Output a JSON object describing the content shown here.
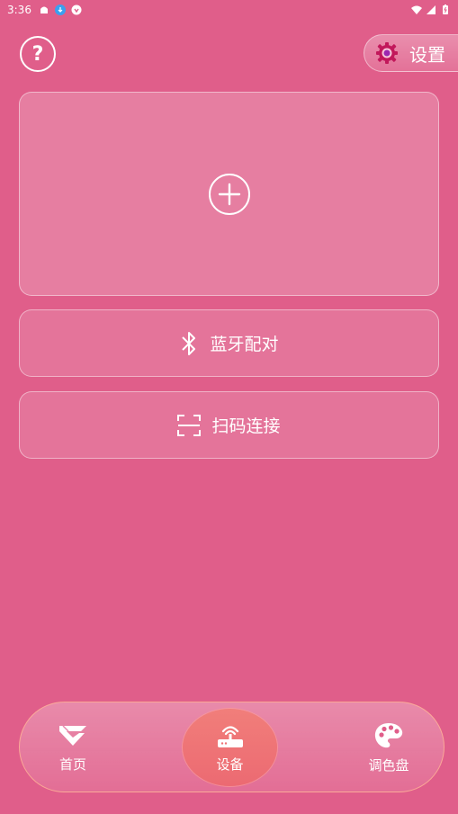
{
  "status_bar": {
    "time": "3:36"
  },
  "header": {
    "help_symbol": "?",
    "settings_label": "设置",
    "settings_icon": "gear-icon"
  },
  "main": {
    "add_icon": "plus-circle-icon",
    "bluetooth_label": "蓝牙配对",
    "bluetooth_icon": "bluetooth-icon",
    "scan_label": "扫码连接",
    "scan_icon": "scan-icon"
  },
  "nav": {
    "items": [
      {
        "label": "首页",
        "icon": "home-logo-icon",
        "active": false
      },
      {
        "label": "设备",
        "icon": "router-icon",
        "active": true
      },
      {
        "label": "调色盘",
        "icon": "palette-icon",
        "active": false
      }
    ]
  },
  "colors": {
    "background": "#e05e8a",
    "active_nav": "#ef7477",
    "settings_gear": "#c2185b"
  }
}
